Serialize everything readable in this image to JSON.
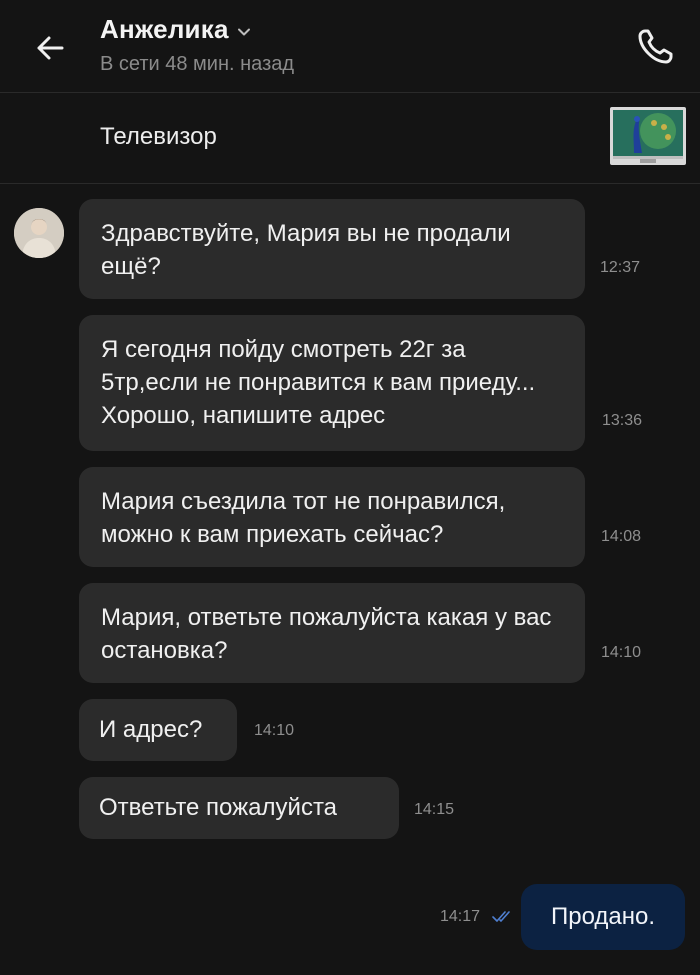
{
  "header": {
    "contact_name": "Анжелика",
    "status": "В сети 48 мин. назад",
    "back_icon": "arrow-left-icon",
    "call_icon": "phone-icon",
    "dropdown_icon": "chevron-down-icon"
  },
  "listing": {
    "title": "Телевизор",
    "thumbnail": "tv-with-peacock-image"
  },
  "messages": [
    {
      "direction": "in",
      "text": "Здравствуйте, Мария вы не продали ещё?",
      "time": "12:37"
    },
    {
      "direction": "in",
      "text": "Я сегодня пойду смотреть 22г за 5тр,если не понравится к вам приеду... Хорошо, напишите адрес",
      "time": "13:36"
    },
    {
      "direction": "in",
      "text": "Мария съездила тот не понравился, можно к вам приехать сейчас?",
      "time": "14:08"
    },
    {
      "direction": "in",
      "text": "Мария, ответьте пожалуйста какая у вас остановка?",
      "time": "14:10"
    },
    {
      "direction": "in",
      "text": "И адрес?",
      "time": "14:10"
    },
    {
      "direction": "in",
      "text": "Ответьте пожалуйста",
      "time": "14:15"
    },
    {
      "direction": "out",
      "text": "Продано.",
      "time": "14:17",
      "read_icon": "double-check-icon"
    }
  ],
  "colors": {
    "background": "#141414",
    "incoming_bubble": "#2b2b2b",
    "outgoing_bubble": "#0c2242",
    "read_ticks": "#4f7fd0"
  }
}
